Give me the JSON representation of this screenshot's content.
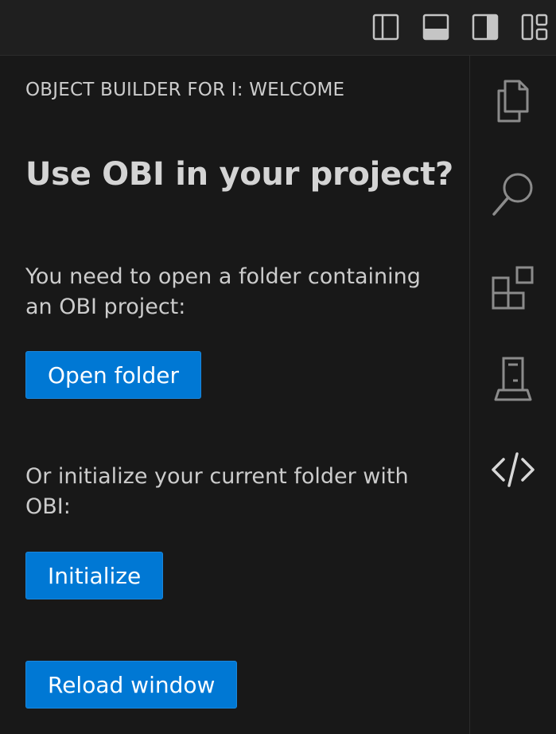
{
  "titlebar": {
    "layout_controls": [
      {
        "icon": "toggle-primary-sidebar-icon"
      },
      {
        "icon": "toggle-panel-icon"
      },
      {
        "icon": "toggle-secondary-sidebar-icon"
      },
      {
        "icon": "customize-layout-icon"
      }
    ]
  },
  "sidebar": {
    "section_title": "OBJECT BUILDER FOR I: WELCOME",
    "heading": "Use OBI in your project?",
    "open_prompt": "You need to open a folder containing an OBI project:",
    "open_button": "Open folder",
    "init_prompt": "Or initialize your current folder with OBI:",
    "init_button": "Initialize",
    "reload_button": "Reload window"
  },
  "activitybar": {
    "items": [
      {
        "icon": "explorer-icon"
      },
      {
        "icon": "search-icon"
      },
      {
        "icon": "extensions-icon"
      },
      {
        "icon": "ibmi-server-icon"
      },
      {
        "icon": "code-icon"
      }
    ]
  },
  "colors": {
    "background": "#181818",
    "titlebar": "#1f1f1f",
    "accent_button": "#0078d4",
    "text": "#cccccc"
  }
}
